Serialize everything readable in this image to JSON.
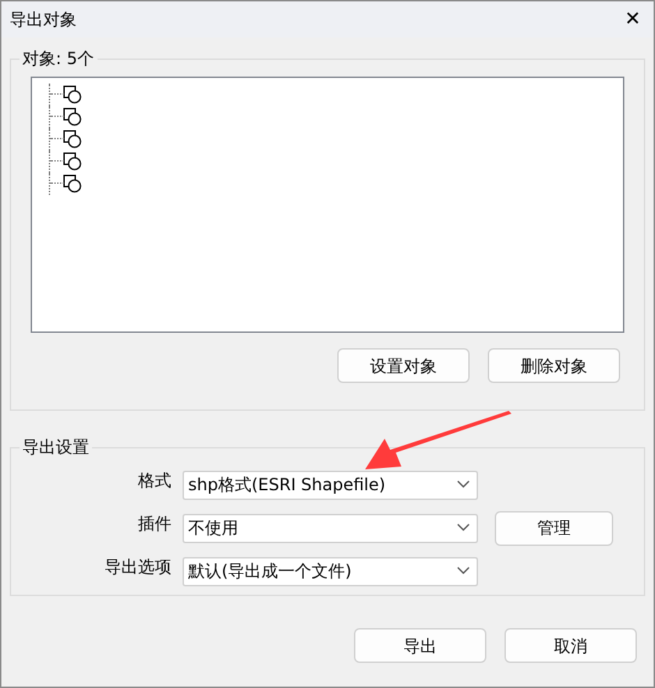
{
  "window": {
    "title": "导出对象",
    "close": "✕"
  },
  "objects_group": {
    "title": "对象: 5个",
    "items": [
      {
        "kind": "shape"
      },
      {
        "kind": "shape"
      },
      {
        "kind": "shape"
      },
      {
        "kind": "shape"
      },
      {
        "kind": "shape"
      }
    ],
    "buttons": [
      "设置对象",
      "删除对象"
    ]
  },
  "export_settings": {
    "title": "导出设置",
    "rows": [
      {
        "label": "格式",
        "value": "shp格式(ESRI Shapefile)"
      },
      {
        "label": "插件",
        "value": "不使用",
        "button": "管理"
      },
      {
        "label": "导出选项",
        "value": "默认(导出成一个文件)"
      }
    ]
  },
  "buttons": [
    "导出",
    "取消"
  ]
}
